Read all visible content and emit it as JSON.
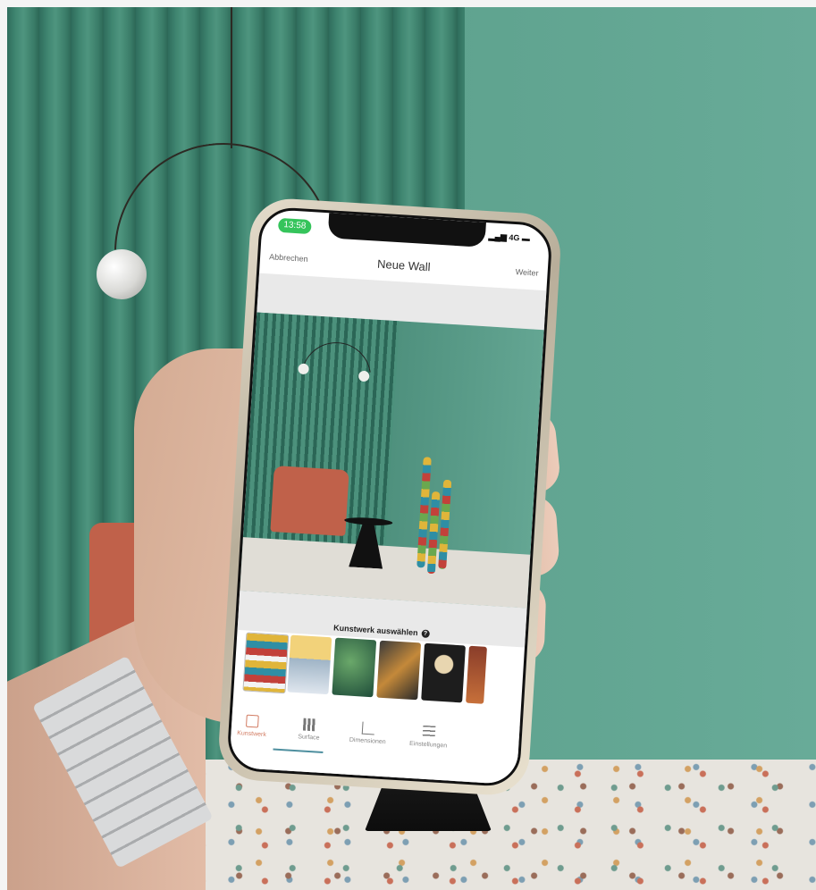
{
  "phone_ui": {
    "status": {
      "time": "13:58",
      "network": "4G"
    },
    "nav": {
      "cancel": "Abbrechen",
      "title": "Neue Wall",
      "next": "Weiter"
    },
    "chooser": {
      "label": "Kunstwerk auswählen",
      "help_glyph": "?"
    },
    "tabs": [
      {
        "label": "Kunstwerk",
        "icon": "frame-icon",
        "active": true
      },
      {
        "label": "Surface",
        "icon": "grid-icon",
        "active": false
      },
      {
        "label": "Dimensionen",
        "icon": "dimensions-icon",
        "active": false
      },
      {
        "label": "Einstellungen",
        "icon": "sliders-icon",
        "active": false
      }
    ]
  },
  "colors": {
    "wall": "#5c9f8b",
    "accent_tab": "#d27c63",
    "status_pill": "#35c45b"
  }
}
